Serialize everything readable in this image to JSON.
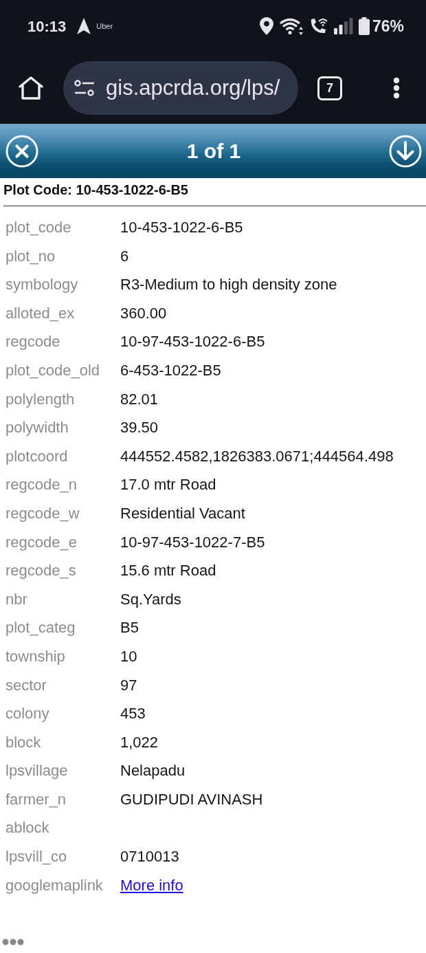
{
  "status_bar": {
    "time": "10:13",
    "notification_label": "Uber",
    "battery_percent": "76%"
  },
  "browser_toolbar": {
    "url": "gis.apcrda.org/lps/",
    "tab_count": "7"
  },
  "popup": {
    "title": "1 of 1",
    "heading": "Plot Code: 10-453-1022-6-B5",
    "fields": [
      {
        "label": "plot_code",
        "value": "10-453-1022-6-B5",
        "kind": "text"
      },
      {
        "label": "plot_no",
        "value": "6",
        "kind": "text"
      },
      {
        "label": "symbology",
        "value": "R3-Medium to high density zone",
        "kind": "text"
      },
      {
        "label": "alloted_ex",
        "value": "360.00",
        "kind": "text"
      },
      {
        "label": "regcode",
        "value": "10-97-453-1022-6-B5",
        "kind": "text"
      },
      {
        "label": "plot_code_old",
        "value": "6-453-1022-B5",
        "kind": "text"
      },
      {
        "label": "polylength",
        "value": "82.01",
        "kind": "text"
      },
      {
        "label": "polywidth",
        "value": "39.50",
        "kind": "text"
      },
      {
        "label": "plotcoord",
        "value": "444552.4582,1826383.0671;444564.498",
        "kind": "text"
      },
      {
        "label": "regcode_n",
        "value": "17.0 mtr Road",
        "kind": "text"
      },
      {
        "label": "regcode_w",
        "value": "Residential Vacant",
        "kind": "text"
      },
      {
        "label": "regcode_e",
        "value": "10-97-453-1022-7-B5",
        "kind": "text"
      },
      {
        "label": "regcode_s",
        "value": "15.6 mtr Road",
        "kind": "text"
      },
      {
        "label": "nbr",
        "value": "Sq.Yards",
        "kind": "text"
      },
      {
        "label": "plot_categ",
        "value": "B5",
        "kind": "text"
      },
      {
        "label": "township",
        "value": "10",
        "kind": "text"
      },
      {
        "label": "sector",
        "value": "97",
        "kind": "text"
      },
      {
        "label": "colony",
        "value": "453",
        "kind": "text"
      },
      {
        "label": "block",
        "value": "1,022",
        "kind": "text"
      },
      {
        "label": "lpsvillage",
        "value": "Nelapadu",
        "kind": "text"
      },
      {
        "label": "farmer_n",
        "value": "GUDIPUDI AVINASH",
        "kind": "text"
      },
      {
        "label": "ablock"
      },
      {
        "label": "lpsvill_co",
        "value": "0710013",
        "kind": "text"
      },
      {
        "label": "googlemaplink",
        "value": "More info",
        "kind": "link"
      }
    ]
  }
}
